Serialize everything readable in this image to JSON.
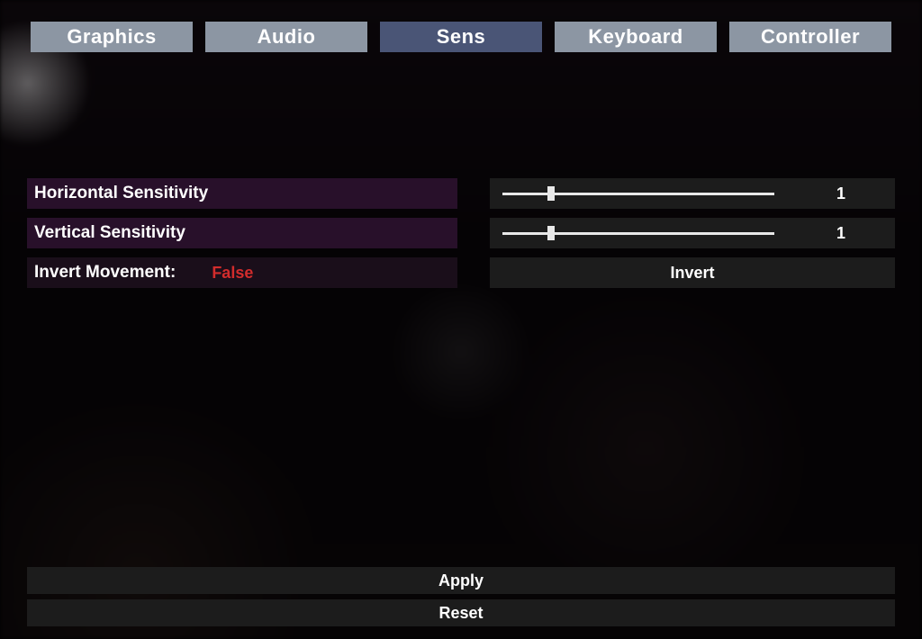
{
  "tabs": {
    "graphics": "Graphics",
    "audio": "Audio",
    "sens": "Sens",
    "keyboard": "Keyboard",
    "controller": "Controller",
    "active": "sens"
  },
  "settings": {
    "horizontal": {
      "label": "Horizontal Sensitivity",
      "value": "1",
      "percent": 18
    },
    "vertical": {
      "label": "Vertical Sensitivity",
      "value": "1",
      "percent": 18
    },
    "invert": {
      "label": "Invert Movement:",
      "status": "False",
      "button": "Invert"
    }
  },
  "footer": {
    "apply": "Apply",
    "reset": "Reset"
  },
  "colors": {
    "tab_inactive": "#8c96a3",
    "tab_active": "#4a5576",
    "row_label_bg": "#28102a",
    "row_control_bg": "#1c1c1c",
    "status_false": "#d22c2c"
  }
}
